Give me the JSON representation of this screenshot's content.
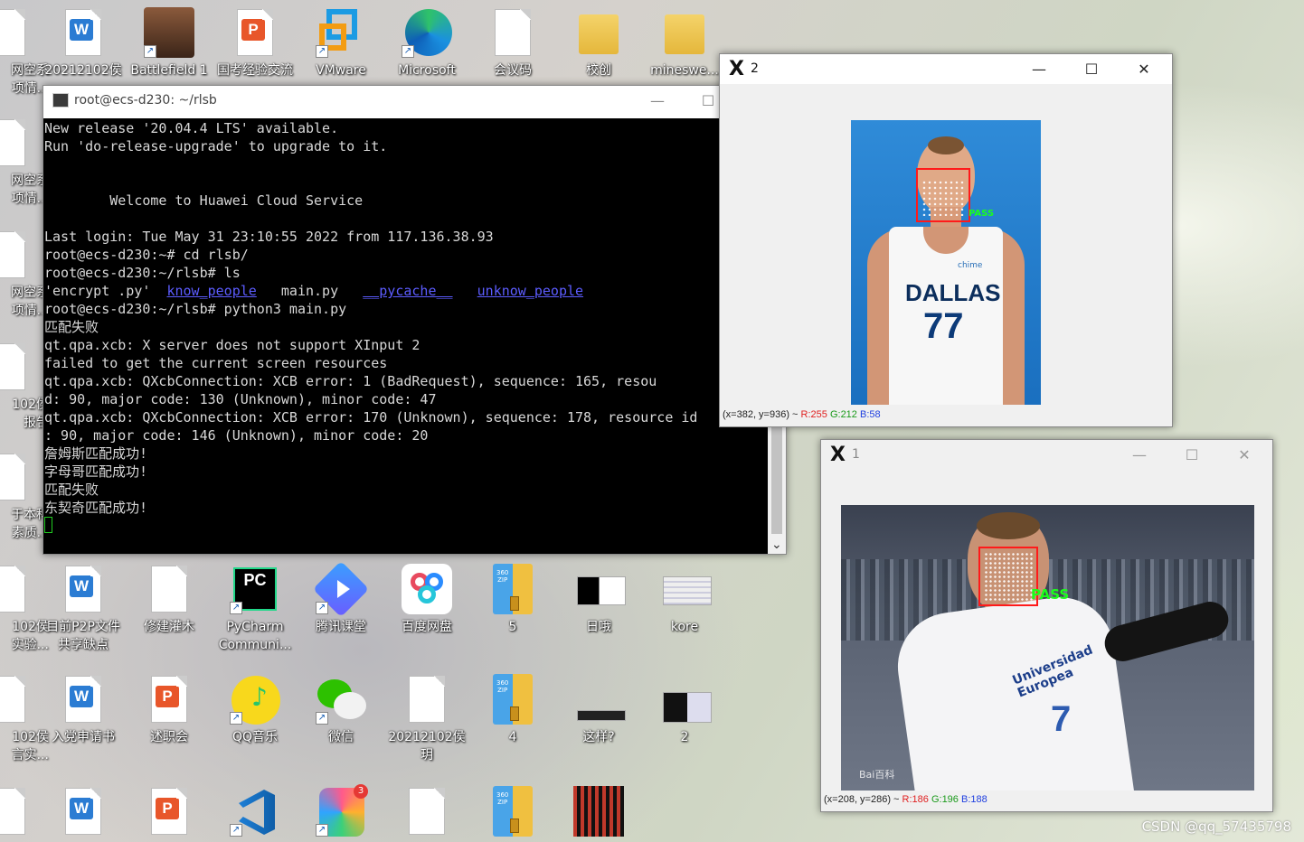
{
  "desktop": {
    "top_row": [
      "20212102侯",
      "Battlefield 1",
      "国考经验交流",
      "VMware",
      "Microsoft",
      "会议码",
      "校创",
      "mineswe..."
    ],
    "left_col": [
      "网空系\n项情...",
      "网空系\n项情...",
      "网空系\n项情...",
      "102侯\n报告",
      "于本科\n素质...",
      "102侯\n实验...",
      "102侯\n言实..."
    ],
    "row3": [
      "目前P2P文件\n共享缺点",
      "修建灌木",
      "PyCharm\nCommuni...",
      "腾讯课堂",
      "百度网盘",
      "5",
      "日哦",
      "kore"
    ],
    "row4": [
      "入党申请书",
      "述职会",
      "QQ音乐",
      "微信",
      "20212102侯\n玥",
      "4",
      "这样?",
      "2"
    ],
    "notif_badge": "3",
    "zip_label": "360\nZIP",
    "pc_label": "PC"
  },
  "terminal": {
    "title": "root@ecs-d230: ~/rlsb",
    "min": "—",
    "max": "☐",
    "lines": [
      "New release '20.04.4 LTS' available.",
      "Run 'do-release-upgrade' to upgrade to it.",
      "",
      "",
      "        Welcome to Huawei Cloud Service",
      "",
      "Last login: Tue May 31 23:10:55 2022 from 117.136.38.93",
      "root@ecs-d230:~# cd rlsb/",
      "root@ecs-d230:~/rlsb# ls"
    ],
    "ls": {
      "f1": "'encrypt .py'",
      "d1": "know_people",
      "f2": "main.py",
      "d2": "__pycache__",
      "d3": "unknow_people"
    },
    "lines2": [
      "root@ecs-d230:~/rlsb# python3 main.py",
      "匹配失败",
      "qt.qpa.xcb: X server does not support XInput 2",
      "failed to get the current screen resources",
      "qt.qpa.xcb: QXcbConnection: XCB error: 1 (BadRequest), sequence: 165, resou",
      "d: 90, major code: 130 (Unknown), minor code: 47",
      "qt.qpa.xcb: QXcbConnection: XCB error: 170 (Unknown), sequence: 178, resource id",
      ": 90, major code: 146 (Unknown), minor code: 20",
      "詹姆斯匹配成功!",
      "字母哥匹配成功!",
      "匹配失败",
      "东契奇匹配成功!"
    ],
    "scroll_down": "⌄"
  },
  "win2": {
    "title": "2",
    "status_pos": "(x=382, y=936) ~ ",
    "r": "R:255",
    "g": "G:212",
    "b": "B:58",
    "pass": "PASS",
    "jersey_city": "DALLAS",
    "jersey_num": "77",
    "sponsor": "chime"
  },
  "win1": {
    "title": "1",
    "status_pos": "(x=208, y=286) ~ ",
    "r": "R:186",
    "g": "G:196",
    "b": "B:188",
    "pass": "PASS",
    "jersey_sponsor": "Universidad\nEuropea",
    "jersey_num": "7",
    "baidu": "Bai百科"
  },
  "window_controls": {
    "min": "—",
    "max": "☐",
    "close": "✕"
  },
  "watermark": "CSDN @qq_57435798"
}
